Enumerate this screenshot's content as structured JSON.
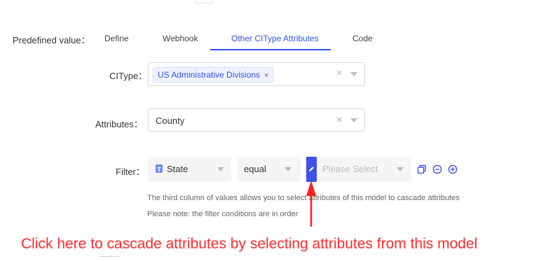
{
  "form": {
    "predefined_label": "Predefined value：",
    "tabs": [
      {
        "label": "Define"
      },
      {
        "label": "Webhook"
      },
      {
        "label": "Other CIType Attributes"
      },
      {
        "label": "Code"
      }
    ],
    "active_tab": "Other CIType Attributes",
    "citype": {
      "label": "CIType：",
      "selected_tag": "US Administrative Divisions",
      "tag_remove_glyph": "×",
      "clear_glyph": "×"
    },
    "attributes": {
      "label": "Attributes：",
      "value": "County",
      "clear_glyph": "×"
    },
    "filter": {
      "label": "Filter：",
      "attribute": "State",
      "attribute_type_icon": "text-attribute-icon",
      "operator": "equal",
      "value_placeholder": "Please Select"
    },
    "hints": [
      "The third column of values allows you to select attributes of this model to cascade attributes",
      "Please note: the filter conditions are in order"
    ]
  },
  "annotation": {
    "text": "Click here to cascade attributes by selecting attributes from this model",
    "color": "#ff2a2a"
  },
  "colors": {
    "accent": "#2f54eb",
    "edit_button": "#3f51e6"
  }
}
